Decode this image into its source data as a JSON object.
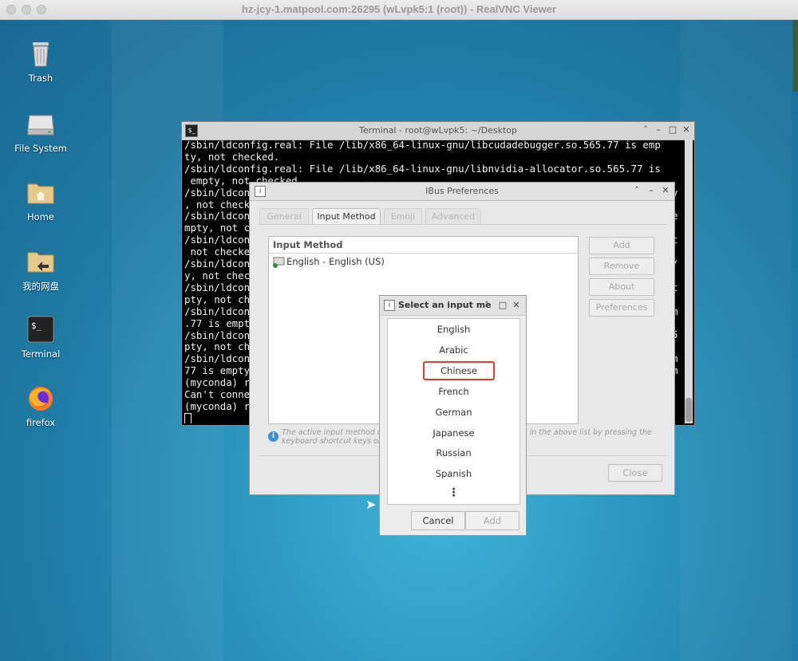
{
  "window": {
    "title": "hz-jcy-1.matpool.com:26295 (wLvpk5:1 (root)) - RealVNC Viewer"
  },
  "desktop_icons": [
    {
      "label": "Trash",
      "icon": "trash-icon"
    },
    {
      "label": "File System",
      "icon": "drive-icon"
    },
    {
      "label": "Home",
      "icon": "home-folder-icon"
    },
    {
      "label": "我的网盘",
      "icon": "folder-link-icon"
    },
    {
      "label": "Terminal",
      "icon": "terminal-icon"
    },
    {
      "label": "firefox",
      "icon": "firefox-icon"
    }
  ],
  "terminal": {
    "title": "Terminal - root@wLvpk5: ~/Desktop",
    "lines": [
      "/sbin/ldconfig.real: File /lib/x86_64-linux-gnu/libcudadebugger.so.565.77 is emp",
      "ty, not checked.",
      "/sbin/ldconfig.real: File /lib/x86_64-linux-gnu/libnvidia-allocator.so.565.77 is",
      " empty, not checked.",
      "/sbin/ldcon",
      ", not check",
      "/sbin/ldcon",
      "mpty, not c",
      "/sbin/ldcon",
      " not checke",
      "/sbin/ldcon",
      "y, not chec",
      "/sbin/ldcon",
      "pty, not ch",
      "/sbin/ldcon",
      ".77 is empt",
      "/sbin/ldcon",
      "pty, not ch",
      "/sbin/ldcon",
      "77 is empty",
      "(myconda) r",
      "Can't conne",
      "(myconda) r"
    ],
    "right_fragments": [
      "y",
      "e",
      "t",
      "/",
      "t",
      "m",
      "5",
      "m",
      "m"
    ]
  },
  "ibus": {
    "title": "IBus Preferences",
    "tabs": [
      "General",
      "Input Method",
      "Emoji",
      "Advanced"
    ],
    "list_header": "Input Method",
    "list_items": [
      "English - English (US)"
    ],
    "buttons": [
      "Add",
      "Remove",
      "About",
      "Preferences"
    ],
    "info_line1": "The active input method ca",
    "info_line1_end": "nes in the above list by pressing the",
    "info_line2": "keyboard shortcut keys or c",
    "close_label": "Close"
  },
  "select_dialog": {
    "title": "Select an input me",
    "languages": [
      "English",
      "Arabic",
      "Chinese",
      "French",
      "German",
      "Japanese",
      "Russian",
      "Spanish"
    ],
    "selected": "Chinese",
    "more": "⋮",
    "cancel_label": "Cancel",
    "add_label": "Add"
  },
  "colors": {
    "highlight_border": "#e23a2e",
    "desktop": "#2a86ab"
  }
}
